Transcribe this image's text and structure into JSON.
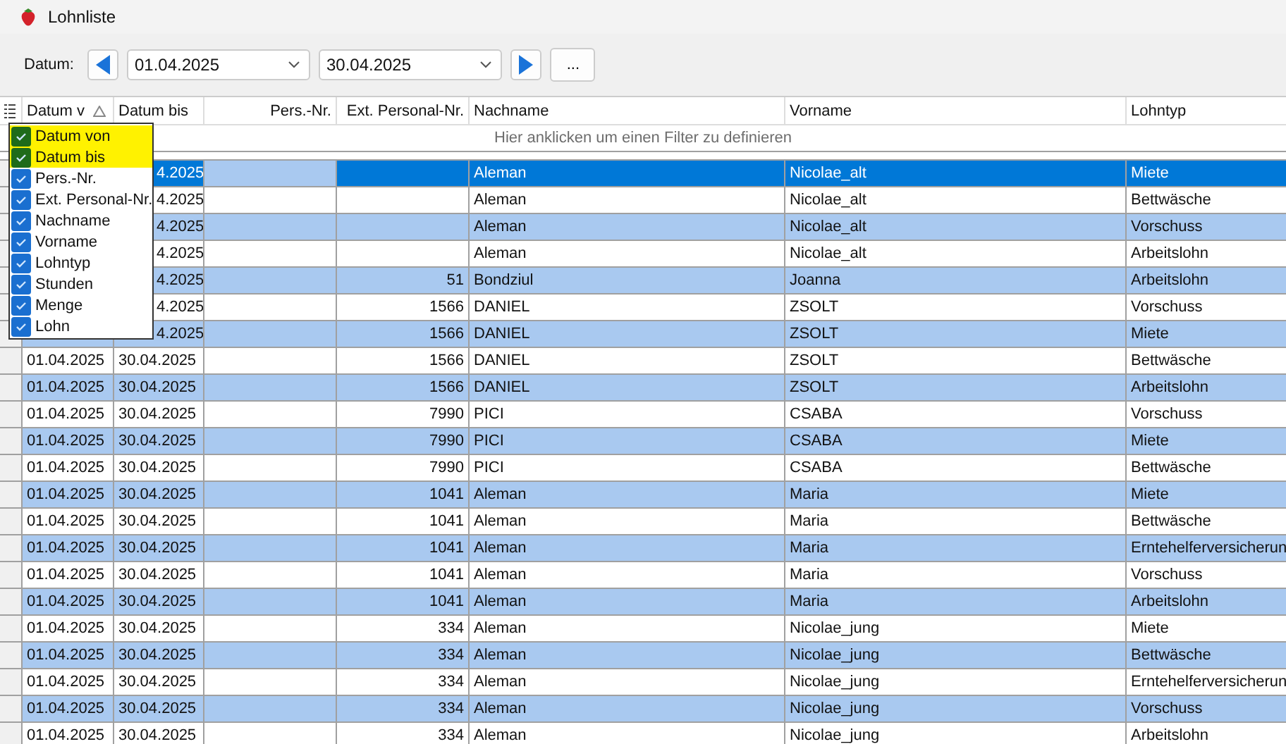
{
  "window": {
    "title": "Lohnliste"
  },
  "toolbar": {
    "label": "Datum:",
    "date_from": "01.04.2025",
    "date_to": "30.04.2025",
    "more_button": "..."
  },
  "table": {
    "columns": [
      {
        "label": "Datum v",
        "sorted": true
      },
      {
        "label": "Datum bis",
        "sorted": false
      },
      {
        "label": "Pers.-Nr.",
        "sorted": false
      },
      {
        "label": "Ext. Personal-Nr.",
        "sorted": false
      },
      {
        "label": "Nachname",
        "sorted": false
      },
      {
        "label": "Vorname",
        "sorted": false
      },
      {
        "label": "Lohntyp",
        "sorted": false
      }
    ],
    "filter_hint": "Hier anklicken um einen Filter zu definieren",
    "rows": [
      {
        "cells": [
          "",
          "4.2025",
          "",
          "",
          "Aleman",
          "Nicolae_alt",
          "Miete"
        ],
        "selected": true
      },
      {
        "cells": [
          "",
          "4.2025",
          "",
          "",
          "Aleman",
          "Nicolae_alt",
          "Bettwäsche"
        ],
        "selected": false
      },
      {
        "cells": [
          "",
          "4.2025",
          "",
          "",
          "Aleman",
          "Nicolae_alt",
          "Vorschuss"
        ],
        "selected": false
      },
      {
        "cells": [
          "",
          "4.2025",
          "",
          "",
          "Aleman",
          "Nicolae_alt",
          "Arbeitslohn"
        ],
        "selected": false
      },
      {
        "cells": [
          "",
          "4.2025",
          "",
          "51",
          "Bondziul",
          "Joanna",
          "Arbeitslohn"
        ],
        "selected": false
      },
      {
        "cells": [
          "",
          "4.2025",
          "",
          "1566",
          "DANIEL",
          "ZSOLT",
          "Vorschuss"
        ],
        "selected": false
      },
      {
        "cells": [
          "",
          "4.2025",
          "",
          "1566",
          "DANIEL",
          "ZSOLT",
          "Miete"
        ],
        "selected": false
      },
      {
        "cells": [
          "01.04.2025",
          "30.04.2025",
          "",
          "1566",
          "DANIEL",
          "ZSOLT",
          "Bettwäsche"
        ],
        "selected": false
      },
      {
        "cells": [
          "01.04.2025",
          "30.04.2025",
          "",
          "1566",
          "DANIEL",
          "ZSOLT",
          "Arbeitslohn"
        ],
        "selected": false
      },
      {
        "cells": [
          "01.04.2025",
          "30.04.2025",
          "",
          "7990",
          "PICI",
          "CSABA",
          "Vorschuss"
        ],
        "selected": false
      },
      {
        "cells": [
          "01.04.2025",
          "30.04.2025",
          "",
          "7990",
          "PICI",
          "CSABA",
          "Miete"
        ],
        "selected": false
      },
      {
        "cells": [
          "01.04.2025",
          "30.04.2025",
          "",
          "7990",
          "PICI",
          "CSABA",
          "Bettwäsche"
        ],
        "selected": false
      },
      {
        "cells": [
          "01.04.2025",
          "30.04.2025",
          "",
          "1041",
          "Aleman",
          "Maria",
          "Miete"
        ],
        "selected": false
      },
      {
        "cells": [
          "01.04.2025",
          "30.04.2025",
          "",
          "1041",
          "Aleman",
          "Maria",
          "Bettwäsche"
        ],
        "selected": false
      },
      {
        "cells": [
          "01.04.2025",
          "30.04.2025",
          "",
          "1041",
          "Aleman",
          "Maria",
          "Erntehelferversicherun"
        ],
        "selected": false
      },
      {
        "cells": [
          "01.04.2025",
          "30.04.2025",
          "",
          "1041",
          "Aleman",
          "Maria",
          "Vorschuss"
        ],
        "selected": false
      },
      {
        "cells": [
          "01.04.2025",
          "30.04.2025",
          "",
          "1041",
          "Aleman",
          "Maria",
          "Arbeitslohn"
        ],
        "selected": false
      },
      {
        "cells": [
          "01.04.2025",
          "30.04.2025",
          "",
          "334",
          "Aleman",
          "Nicolae_jung",
          "Miete"
        ],
        "selected": false
      },
      {
        "cells": [
          "01.04.2025",
          "30.04.2025",
          "",
          "334",
          "Aleman",
          "Nicolae_jung",
          "Bettwäsche"
        ],
        "selected": false
      },
      {
        "cells": [
          "01.04.2025",
          "30.04.2025",
          "",
          "334",
          "Aleman",
          "Nicolae_jung",
          "Erntehelferversicherun"
        ],
        "selected": false
      },
      {
        "cells": [
          "01.04.2025",
          "30.04.2025",
          "",
          "334",
          "Aleman",
          "Nicolae_jung",
          "Vorschuss"
        ],
        "selected": false
      },
      {
        "cells": [
          "01.04.2025",
          "30.04.2025",
          "",
          "334",
          "Aleman",
          "Nicolae_jung",
          "Arbeitslohn"
        ],
        "selected": false
      }
    ]
  },
  "column_chooser": {
    "items": [
      {
        "label": "Datum von",
        "checked": true,
        "highlighted": true
      },
      {
        "label": "Datum bis",
        "checked": true,
        "highlighted": true
      },
      {
        "label": "Pers.-Nr.",
        "checked": true,
        "highlighted": false
      },
      {
        "label": "Ext. Personal-Nr.",
        "checked": true,
        "highlighted": false
      },
      {
        "label": "Nachname",
        "checked": true,
        "highlighted": false
      },
      {
        "label": "Vorname",
        "checked": true,
        "highlighted": false
      },
      {
        "label": "Lohntyp",
        "checked": true,
        "highlighted": false
      },
      {
        "label": "Stunden",
        "checked": true,
        "highlighted": false
      },
      {
        "label": "Menge",
        "checked": true,
        "highlighted": false
      },
      {
        "label": "Lohn",
        "checked": true,
        "highlighted": false
      }
    ]
  }
}
